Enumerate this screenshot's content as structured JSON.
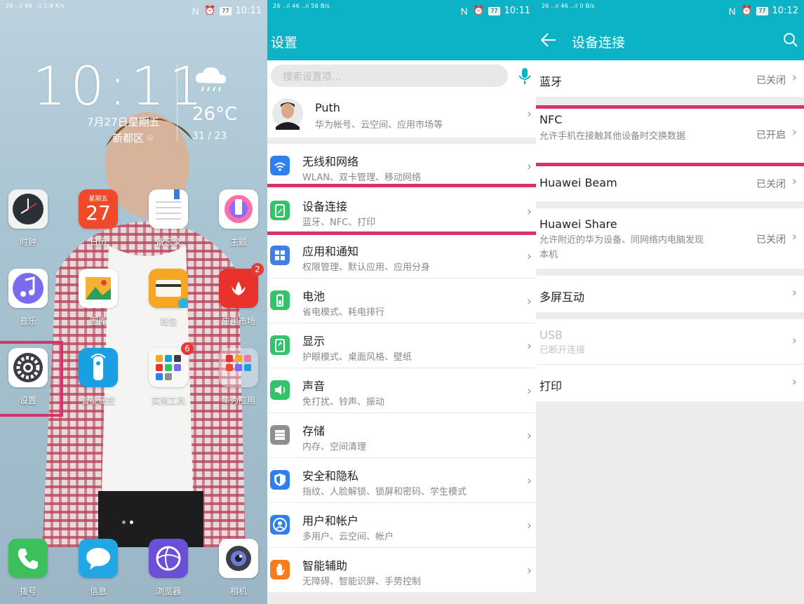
{
  "home": {
    "status": {
      "signal_left": "26 ..ıl 46 ..ıl",
      "speed": "1.9 K/s",
      "battery": "77",
      "time": "10:11"
    },
    "clock": "10:11",
    "date": "7月27日星期五",
    "location": "新都区",
    "weather": {
      "temp": "26°C",
      "range": "31 / 23"
    },
    "apps": [
      {
        "name": "时钟"
      },
      {
        "name": "日历",
        "day_of_week": "星期五",
        "day": "27"
      },
      {
        "name": "备忘录"
      },
      {
        "name": "主题"
      },
      {
        "name": "音乐"
      },
      {
        "name": "图库"
      },
      {
        "name": "钱包"
      },
      {
        "name": "应用市场",
        "badge": "2"
      },
      {
        "name": "设置"
      },
      {
        "name": "智能遥控"
      },
      {
        "name": "实用工具",
        "badge": "6"
      },
      {
        "name": "华为应用"
      }
    ],
    "dock": [
      {
        "name": "拨号"
      },
      {
        "name": "信息"
      },
      {
        "name": "浏览器"
      },
      {
        "name": "相机"
      }
    ]
  },
  "settings": {
    "status": {
      "speed": "56 B/s",
      "battery": "77",
      "time": "10:11"
    },
    "title": "设置",
    "search_placeholder": "搜索设置项...",
    "account": {
      "name": "Puth",
      "subtitle": "华为帐号、云空间、应用市场等"
    },
    "items": [
      {
        "title": "无线和网络",
        "subtitle": "WLAN、双卡管理、移动网络",
        "color": "#2f80ed",
        "icon": "wifi-icon"
      },
      {
        "title": "设备连接",
        "subtitle": "蓝牙、NFC、打印",
        "color": "#33c46a",
        "icon": "device-connect-icon"
      },
      {
        "title": "应用和通知",
        "subtitle": "权限管理、默认应用、应用分身",
        "color": "#3f7fe6",
        "icon": "apps-grid-icon"
      },
      {
        "title": "电池",
        "subtitle": "省电模式、耗电排行",
        "color": "#33c46a",
        "icon": "battery-icon"
      },
      {
        "title": "显示",
        "subtitle": "护眼模式、桌面风格、壁纸",
        "color": "#33c46a",
        "icon": "display-icon"
      },
      {
        "title": "声音",
        "subtitle": "免打扰、铃声、振动",
        "color": "#33c46a",
        "icon": "sound-icon"
      },
      {
        "title": "存储",
        "subtitle": "内存、空间清理",
        "color": "#8e8e93",
        "icon": "storage-icon"
      },
      {
        "title": "安全和隐私",
        "subtitle": "指纹、人脸解锁、锁屏和密码、学生模式",
        "color": "#2f80ed",
        "icon": "shield-icon"
      },
      {
        "title": "用户和帐户",
        "subtitle": "多用户、云空间、帐户",
        "color": "#2f80ed",
        "icon": "user-icon"
      },
      {
        "title": "智能辅助",
        "subtitle": "无障碍、智能识屏、手势控制",
        "color": "#f57c1f",
        "icon": "hand-icon"
      }
    ]
  },
  "device": {
    "status": {
      "speed": "0 B/s",
      "battery": "77",
      "time": "10:12"
    },
    "title": "设备连接",
    "items": [
      {
        "title": "蓝牙",
        "status": "已关闭"
      },
      {
        "title": "NFC",
        "subtitle": "允许手机在接触其他设备时交换数据",
        "status": "已开启"
      },
      {
        "title": "Huawei Beam",
        "status": "已关闭"
      },
      {
        "title": "Huawei Share",
        "subtitle": "允许附近的华为设备、同网络内电脑发现本机",
        "status": "已关闭"
      },
      {
        "title": "多屏互动"
      },
      {
        "title": "USB",
        "subtitle": "已断开连接"
      },
      {
        "title": "打印"
      }
    ]
  }
}
